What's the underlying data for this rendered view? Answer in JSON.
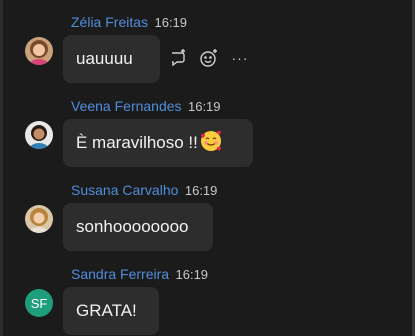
{
  "messages": [
    {
      "sender": "Zélia Freitas",
      "time": "16:19",
      "text": "uauuuu",
      "avatar": "photo-avatar"
    },
    {
      "sender": "Veena Fernandes",
      "time": "16:19",
      "text": "È maravilhoso !!",
      "emoji": "smiling-face-with-hearts",
      "avatar": "photo-avatar"
    },
    {
      "sender": "Susana Carvalho",
      "time": "16:19",
      "text": "sonhoooooooo",
      "avatar": "photo-avatar"
    },
    {
      "sender": "Sandra Ferreira",
      "time": "16:19",
      "text": "GRATA!",
      "initials": "SF",
      "avatar_color": "#1f9e7e"
    }
  ],
  "hover_actions": {
    "reply_icon": "reply-icon",
    "react_icon": "add-reaction-icon",
    "more_label": "···"
  },
  "colors": {
    "background": "#1b1b1b",
    "bubble": "#2d2d2d",
    "sender_name": "#4f8edc",
    "message_text": "#f2f2f2"
  }
}
